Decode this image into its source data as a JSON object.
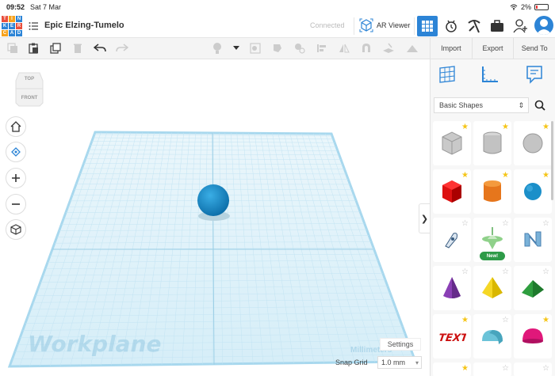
{
  "status_bar": {
    "time": "09:52",
    "date": "Sat 7 Mar",
    "battery": "2%"
  },
  "logo": {
    "letters": [
      "T",
      "I",
      "N",
      "K",
      "E",
      "R",
      "C",
      "A",
      "D"
    ],
    "colors": [
      "#e94e3c",
      "#f7a21c",
      "#2c84d6",
      "#2c84d6",
      "#2c84d6",
      "#e94e3c",
      "#f7a21c",
      "#2c84d6",
      "#2c84d6"
    ]
  },
  "header": {
    "project_title": "Epic Elzing-Tumelo",
    "connection_status": "Connected",
    "ar_viewer_label": "AR Viewer"
  },
  "actions": {
    "import_label": "Import",
    "export_label": "Export",
    "send_to_label": "Send To"
  },
  "viewcube": {
    "top_label": "TOP",
    "front_label": "FRONT"
  },
  "workplane": {
    "label": "Workplane",
    "units": "Millimeters",
    "settings_label": "Settings",
    "snap_label": "Snap Grid",
    "snap_value": "1.0 mm"
  },
  "panel": {
    "category": "Basic Shapes",
    "new_badge": "New!"
  },
  "colors": {
    "accent": "#2c84d6",
    "grid": "#cfeaf6",
    "star": "#f5c518"
  }
}
